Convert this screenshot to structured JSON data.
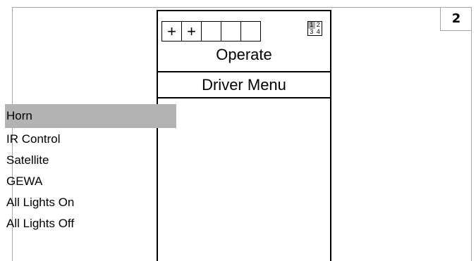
{
  "page_number": "2",
  "status_bar": {
    "slots": [
      "+",
      "+",
      "",
      "",
      ""
    ],
    "profile_grid": [
      "1",
      "2",
      "3",
      "4"
    ],
    "active_profile": "1"
  },
  "profile_name": "Operate",
  "menu_title": "Driver Menu",
  "menu_items": [
    {
      "label": "Horn",
      "selected": true
    },
    {
      "label": "IR Control",
      "selected": false
    },
    {
      "label": "Satellite",
      "selected": false
    },
    {
      "label": "GEWA",
      "selected": false
    },
    {
      "label": "All Lights On",
      "selected": false
    },
    {
      "label": "All Lights Off",
      "selected": false
    }
  ],
  "colors": {
    "highlight": "#b3b3b3",
    "frame": "#a7a7a7"
  }
}
